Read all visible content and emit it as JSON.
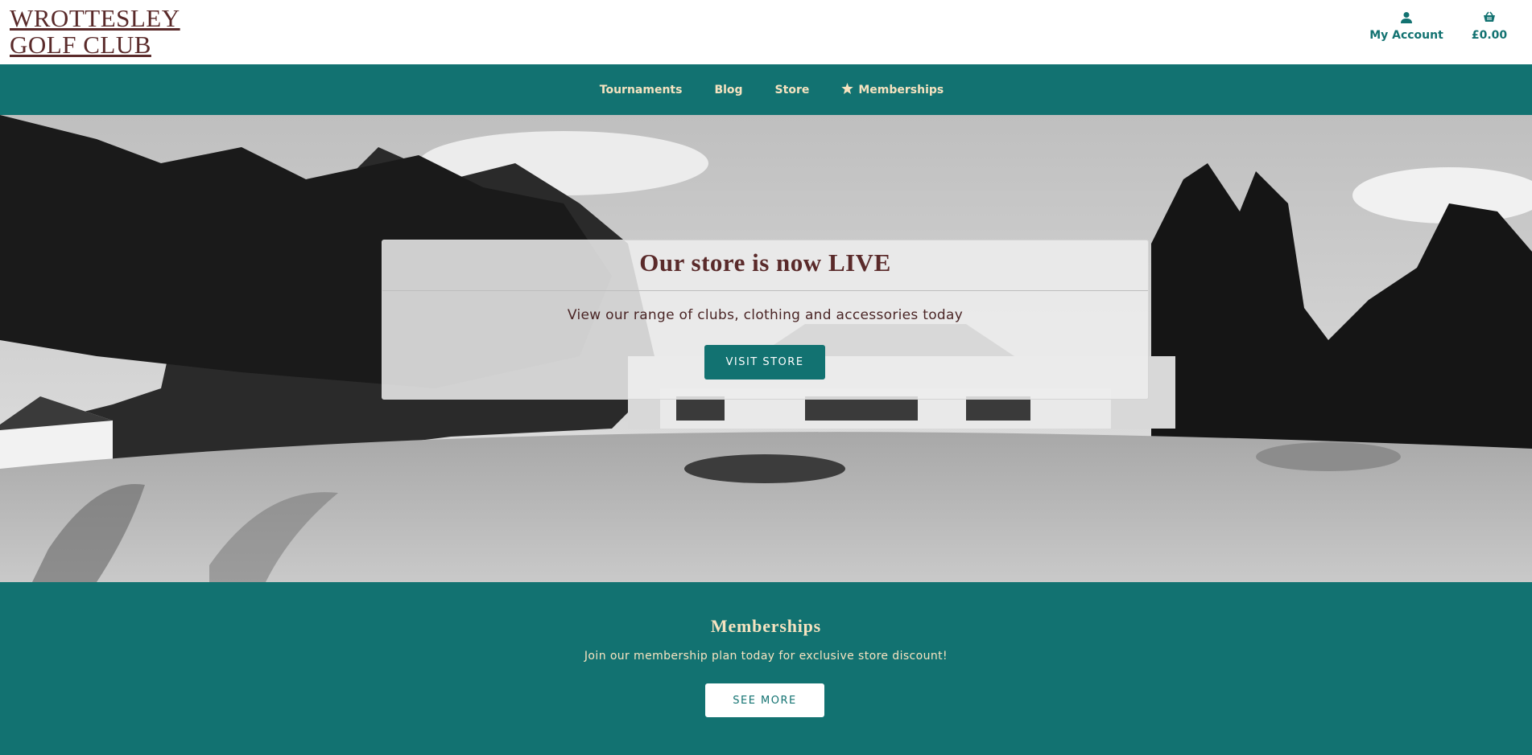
{
  "brand": {
    "line1": "WROTTESLEY",
    "line2": "GOLF CLUB"
  },
  "header": {
    "account_label": "My Account",
    "account_icon": "user-icon",
    "cart_total": "£0.00",
    "cart_icon": "basket-icon"
  },
  "nav": {
    "items": [
      {
        "label": "Tournaments"
      },
      {
        "label": "Blog"
      },
      {
        "label": "Store"
      },
      {
        "label": "Memberships",
        "icon": "star-icon"
      }
    ]
  },
  "hero": {
    "title": "Our store is now LIVE",
    "subtitle": "View our range of clubs, clothing and accessories today",
    "button_label": "VISIT STORE"
  },
  "memberships": {
    "title": "Memberships",
    "text": "Join our membership plan today for exclusive store discount!",
    "button_label": "SEE MORE"
  },
  "colors": {
    "teal": "#127271",
    "cream": "#f6e3c0",
    "maroon": "#5a2a2a"
  }
}
